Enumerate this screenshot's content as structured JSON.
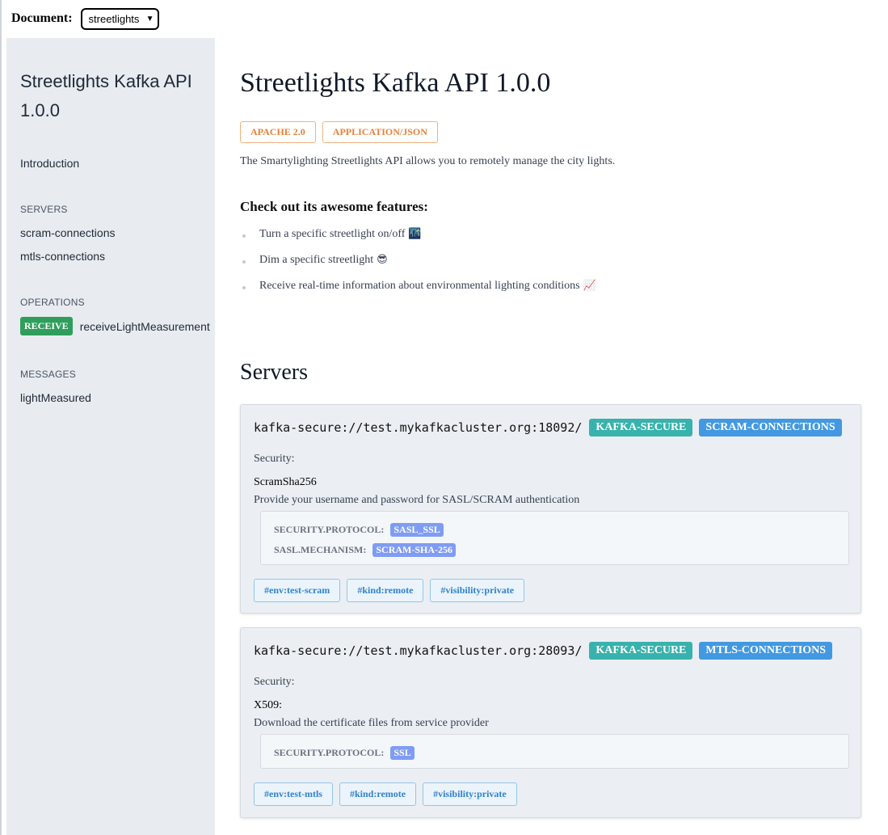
{
  "doc_selector": {
    "label": "Document:",
    "selected": "streetlights"
  },
  "sidebar": {
    "title": "Streetlights Kafka API 1.0.0",
    "introduction": "Introduction",
    "servers_heading": "SERVERS",
    "servers": [
      "scram-connections",
      "mtls-connections"
    ],
    "operations_heading": "OPERATIONS",
    "operation": {
      "badge": "RECEIVE",
      "label": "receiveLightMeasurement"
    },
    "messages_heading": "MESSAGES",
    "messages": [
      "lightMeasured"
    ]
  },
  "main": {
    "title": "Streetlights Kafka API 1.0.0",
    "tags": [
      "APACHE 2.0",
      "APPLICATION/JSON"
    ],
    "description": "The Smartylighting Streetlights API allows you to remotely manage the city lights.",
    "features_title": "Check out its awesome features:",
    "features": [
      {
        "text": "Turn a specific streetlight on/off",
        "emoji": "🌃"
      },
      {
        "text": "Dim a specific streetlight",
        "emoji": "😎"
      },
      {
        "text": "Receive real-time information about environmental lighting conditions",
        "emoji": "📈"
      }
    ],
    "servers_title": "Servers",
    "servers": [
      {
        "url": "kafka-secure://test.mykafkacluster.org:18092/",
        "protocol": "KAFKA-SECURE",
        "name": "SCRAM-CONNECTIONS",
        "security_label": "Security:",
        "scheme": "ScramSha256",
        "scheme_desc": "Provide your username and password for SASL/SCRAM authentication",
        "bindings": [
          {
            "key": "SECURITY.PROTOCOL:",
            "value": "SASL_SSL"
          },
          {
            "key": "SASL.MECHANISM:",
            "value": "SCRAM-SHA-256"
          }
        ],
        "tags": [
          "#env:test-scram",
          "#kind:remote",
          "#visibility:private"
        ]
      },
      {
        "url": "kafka-secure://test.mykafkacluster.org:28093/",
        "protocol": "KAFKA-SECURE",
        "name": "MTLS-CONNECTIONS",
        "security_label": "Security:",
        "scheme": "X509:",
        "scheme_desc": "Download the certificate files from service provider",
        "bindings": [
          {
            "key": "SECURITY.PROTOCOL:",
            "value": "SSL"
          }
        ],
        "tags": [
          "#env:test-mtls",
          "#kind:remote",
          "#visibility:private"
        ]
      }
    ]
  },
  "colors": {
    "sidebar_bg": "#e8ecf0",
    "receive_badge": "#2f9e5b",
    "license_tag": "#e4813a",
    "protocol_pill": "#38b2ac",
    "server_name_pill": "#4299e1",
    "binding_value": "#7f9cf5",
    "hash_tag": "#3182ce"
  }
}
